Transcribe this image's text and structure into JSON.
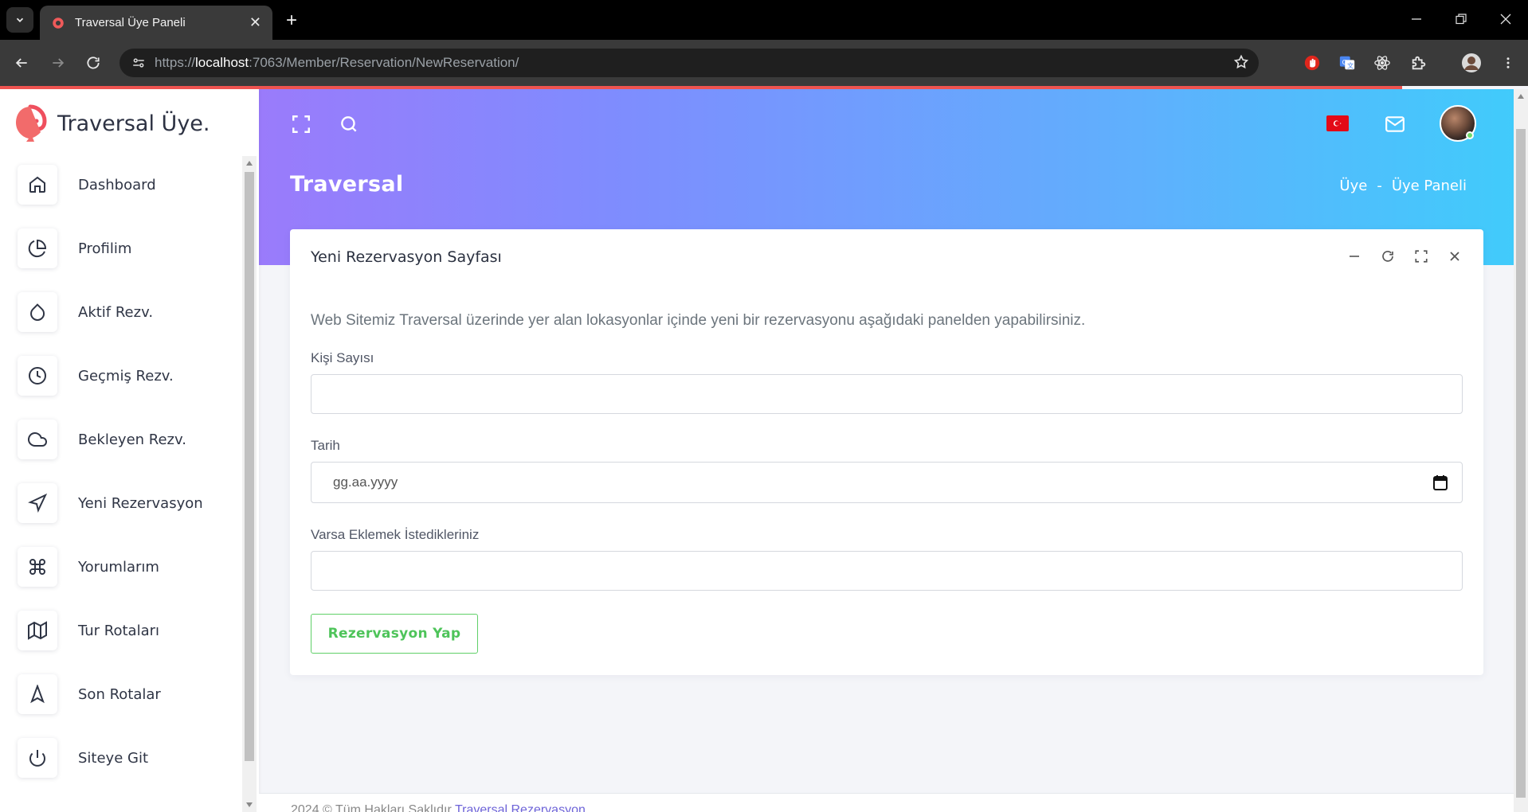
{
  "browser": {
    "tab_title": "Traversal Üye Paneli",
    "url_prefix": "https://",
    "url_host": "localhost",
    "url_rest": ":7063/Member/Reservation/NewReservation/"
  },
  "sidebar": {
    "brand": "Traversal Üye.",
    "items": [
      {
        "label": "Dashboard",
        "icon": "home-icon"
      },
      {
        "label": "Profilim",
        "icon": "pie-chart-icon"
      },
      {
        "label": "Aktif Rezv.",
        "icon": "droplet-icon"
      },
      {
        "label": "Geçmiş Rezv.",
        "icon": "clock-icon"
      },
      {
        "label": "Bekleyen Rezv.",
        "icon": "cloud-icon"
      },
      {
        "label": "Yeni Rezervasyon",
        "icon": "send-icon"
      },
      {
        "label": "Yorumlarım",
        "icon": "command-icon"
      },
      {
        "label": "Tur Rotaları",
        "icon": "map-icon"
      },
      {
        "label": "Son Rotalar",
        "icon": "navigation-icon"
      },
      {
        "label": "Siteye Git",
        "icon": "power-icon"
      }
    ]
  },
  "header": {
    "title": "Traversal",
    "breadcrumb": [
      "Üye",
      "-",
      "Üye Paneli"
    ]
  },
  "card": {
    "title": "Yeni Rezervasyon Sayfası",
    "intro": "Web Sitemiz Traversal üzerinde yer alan lokasyonlar içinde yeni bir rezervasyonu aşağıdaki panelden yapabilirsiniz.",
    "fields": {
      "people_label": "Kişi Sayısı",
      "people_value": "",
      "date_label": "Tarih",
      "date_placeholder": "gg.aa.yyyy",
      "notes_label": "Varsa Eklemek İstedikleriniz",
      "notes_value": ""
    },
    "submit_label": "Rezervasyon Yap"
  },
  "footer": {
    "text": "2024 © Tüm Hakları Saklıdır ",
    "link": "Traversal Rezervasyon"
  },
  "colors": {
    "hero_start": "#9a7bfb",
    "hero_end": "#41cbfb",
    "accent_green": "#4ec45a",
    "loadbar": "#ef5350"
  }
}
